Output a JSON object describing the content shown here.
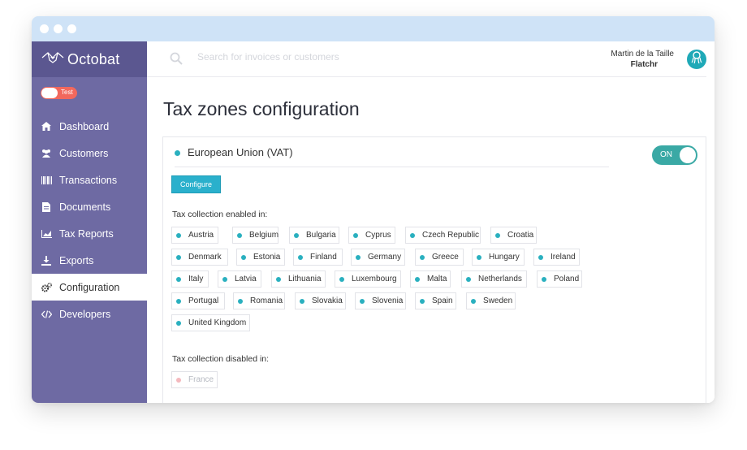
{
  "brand": {
    "name": "Octobat"
  },
  "mode_toggle": {
    "label": "Test"
  },
  "sidebar": {
    "items": [
      {
        "label": "Dashboard",
        "icon": "home-icon"
      },
      {
        "label": "Customers",
        "icon": "users-icon"
      },
      {
        "label": "Transactions",
        "icon": "barcode-icon"
      },
      {
        "label": "Documents",
        "icon": "document-icon"
      },
      {
        "label": "Tax Reports",
        "icon": "chart-icon"
      },
      {
        "label": "Exports",
        "icon": "download-icon"
      },
      {
        "label": "Configuration",
        "icon": "gears-icon",
        "active": true
      },
      {
        "label": "Developers",
        "icon": "code-icon"
      }
    ]
  },
  "search": {
    "placeholder": "Search for invoices or customers"
  },
  "user": {
    "name": "Martin de la Taille",
    "company": "Flatchr"
  },
  "page": {
    "title": "Tax zones configuration"
  },
  "zone": {
    "name": "European Union (VAT)",
    "toggle_label": "ON",
    "configure_label": "Configure",
    "enabled_label": "Tax collection enabled in:",
    "disabled_label": "Tax collection disabled in:",
    "enabled_countries": [
      "Austria",
      "Belgium",
      "Bulgaria",
      "Cyprus",
      "Czech Republic",
      "Croatia",
      "Denmark",
      "Estonia",
      "Finland",
      "Germany",
      "Greece",
      "Hungary",
      "Ireland",
      "Italy",
      "Latvia",
      "Lithuania",
      "Luxembourg",
      "Malta",
      "Netherlands",
      "Poland",
      "Portugal",
      "Romania",
      "Slovakia",
      "Slovenia",
      "Spain",
      "Sweden",
      "United Kingdom"
    ],
    "disabled_countries": [
      "France"
    ]
  },
  "colors": {
    "sidebar": "#6e6aa3",
    "accent": "#2ab0bf",
    "test_toggle": "#f2685d",
    "on_toggle": "#3aa9a5"
  }
}
